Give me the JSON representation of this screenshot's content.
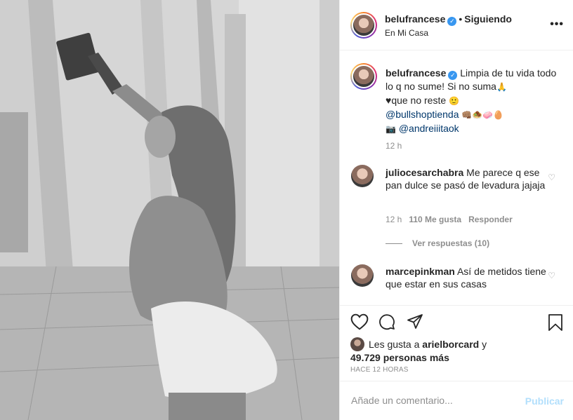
{
  "header": {
    "username": "belufrancese",
    "separator": "•",
    "follow_status": "Siguiendo",
    "location": "En Mi Casa",
    "more_label": "•••"
  },
  "caption": {
    "username": "belufrancese",
    "line1": "Limpia de tu vida todo lo q no sume! Si no suma",
    "emoji_pray": "🙏",
    "line2_heart": "♥",
    "line2": "que no reste",
    "emoji_smile": "🙂",
    "mention1": "@bullshoptienda",
    "emoji_row": "👊🏽🧆🧼🥚",
    "camera_emoji": "📷",
    "mention2": "@andreiiitaok",
    "time": "12 h"
  },
  "comments": [
    {
      "username": "juliocesarchabra",
      "text": "Me parece q ese pan dulce se pasó de levadura jajaja",
      "time": "12 h",
      "likes": "110 Me gusta",
      "reply": "Responder",
      "view_replies": "Ver respuestas (10)"
    },
    {
      "username": "marcepinkman",
      "text": "Así de metidos tiene que estar en sus casas"
    }
  ],
  "actions": {
    "likes_prefix": "Les gusta a",
    "likes_user": "arielborcard",
    "likes_joiner": "y",
    "likes_count": "49.729 personas más",
    "time_ago": "HACE 12 HORAS"
  },
  "composer": {
    "placeholder": "Añade un comentario...",
    "publish": "Publicar"
  },
  "colors": {
    "link": "#00376b",
    "muted": "#8e8e8e",
    "verified": "#3897f0",
    "publish_disabled": "#b2dffc"
  }
}
